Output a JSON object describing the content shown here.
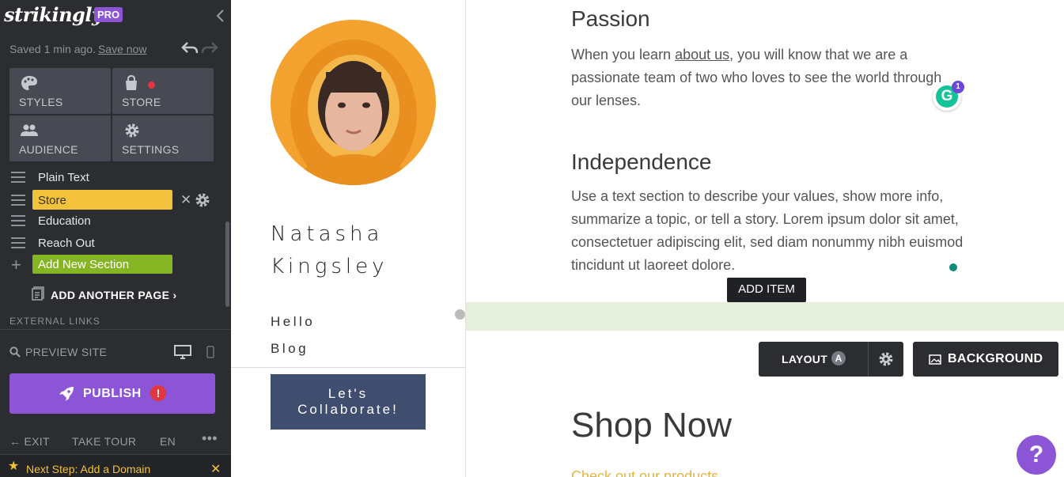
{
  "sidebar": {
    "logo": "strikingly",
    "pro_badge": "PRO",
    "saved_text": "Saved 1 min ago.",
    "save_now": "Save now",
    "tiles": {
      "styles": "STYLES",
      "store": "STORE",
      "audience": "AUDIENCE",
      "settings": "SETTINGS"
    },
    "sections": [
      "Plain Text",
      "Store",
      "Education",
      "Reach Out"
    ],
    "selected_section": "Store",
    "add_section": "Add New Section",
    "add_page": "ADD ANOTHER PAGE",
    "external_links": "EXTERNAL LINKS",
    "preview": "PREVIEW SITE",
    "publish": "PUBLISH",
    "publish_alert": "!",
    "footer": {
      "exit": "EXIT",
      "tour": "TAKE TOUR",
      "lang": "EN",
      "more": "•••"
    },
    "next_step": "Next Step: Add a Domain",
    "accent": "#8b55d6",
    "highlight": "#f3c23a",
    "add_color": "#86b523"
  },
  "profile": {
    "name_line1": "Natasha",
    "name_line2": "Kingsley",
    "nav": [
      "Hello",
      "Blog"
    ],
    "cta_line1": "Let's",
    "cta_line2": "Collaborate!"
  },
  "content": {
    "passion_title": "Passion",
    "passion_pre": "When you learn ",
    "passion_link": "about us",
    "passion_post": ", you will know that we are a passionate team of two who loves to see the world through our lenses.",
    "indep_title": "Independence",
    "indep_text": "Use a text section to describe your values, show more info, summarize a topic, or tell a story. Lorem ipsum dolor sit amet, consectetuer adipiscing elit, sed diam nonummy nibh euismod tincidunt ut laoreet dolore.",
    "add_item": "ADD ITEM",
    "layout": "LAYOUT",
    "layout_badge": "A",
    "background": "BACKGROUND",
    "shop_title": "Shop Now",
    "shop_sub": "Check out our products",
    "grammarly_count": "1",
    "help": "?"
  }
}
